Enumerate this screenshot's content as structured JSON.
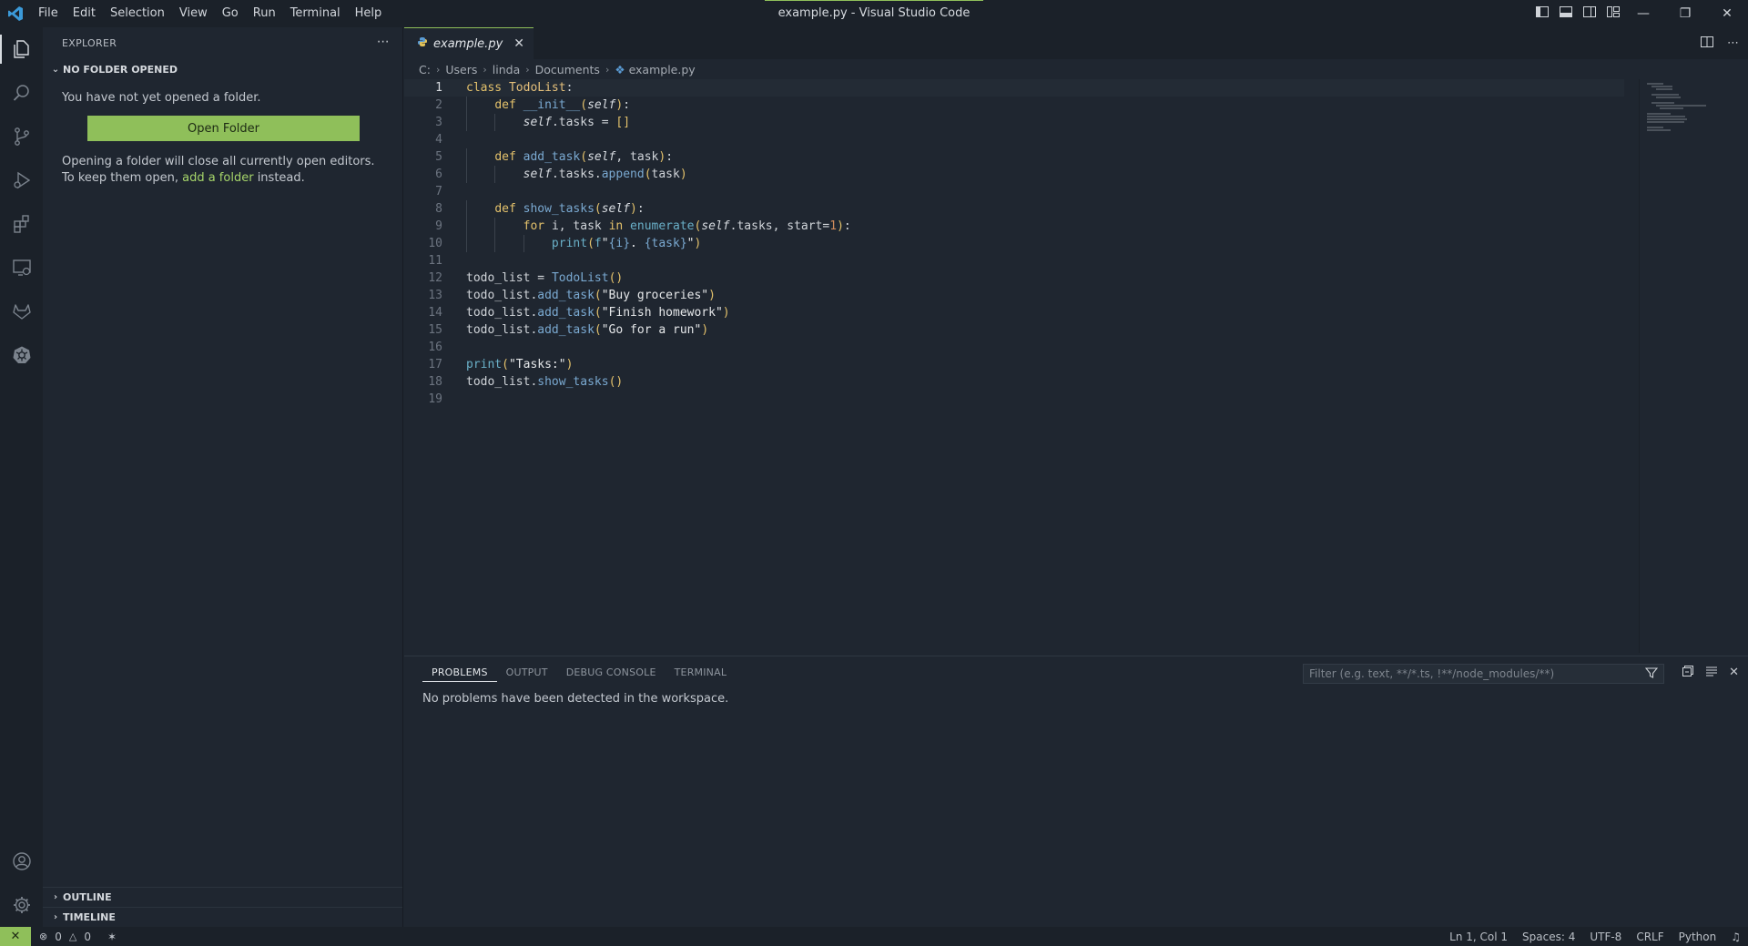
{
  "window": {
    "title": "example.py - Visual Studio Code",
    "menu": [
      "File",
      "Edit",
      "Selection",
      "View",
      "Go",
      "Run",
      "Terminal",
      "Help"
    ]
  },
  "sidebar": {
    "header": "EXPLORER",
    "section": "NO FOLDER OPENED",
    "message": "You have not yet opened a folder.",
    "open_folder_button": "Open Folder",
    "note_prefix": "Opening a folder will close all currently open editors. To keep them open, ",
    "note_link": "add a folder",
    "note_suffix": " instead.",
    "outline": "OUTLINE",
    "timeline": "TIMELINE"
  },
  "editor": {
    "tab_label": "example.py",
    "breadcrumb": [
      "C:",
      "Users",
      "linda",
      "Documents",
      "example.py"
    ],
    "current_line": 1
  },
  "code_lines": [
    "class TodoList:",
    "    def __init__(self):",
    "        self.tasks = []",
    "",
    "    def add_task(self, task):",
    "        self.tasks.append(task)",
    "",
    "    def show_tasks(self):",
    "        for i, task in enumerate(self.tasks, start=1):",
    "            print(f\"{i}. {task}\")",
    "",
    "todo_list = TodoList()",
    "todo_list.add_task(\"Buy groceries\")",
    "todo_list.add_task(\"Finish homework\")",
    "todo_list.add_task(\"Go for a run\")",
    "",
    "print(\"Tasks:\")",
    "todo_list.show_tasks()",
    ""
  ],
  "panel": {
    "tabs": [
      "PROBLEMS",
      "OUTPUT",
      "DEBUG CONSOLE",
      "TERMINAL"
    ],
    "active_tab": "PROBLEMS",
    "filter_placeholder": "Filter (e.g. text, **/*.ts, !**/node_modules/**)",
    "message": "No problems have been detected in the workspace."
  },
  "statusbar": {
    "errors": "0",
    "warnings": "0",
    "position": "Ln 1, Col 1",
    "spaces": "Spaces: 4",
    "encoding": "UTF-8",
    "eol": "CRLF",
    "language": "Python"
  },
  "colors": {
    "accent": "#8fbf5a",
    "background": "#1f2630",
    "chrome": "#1b2129"
  }
}
